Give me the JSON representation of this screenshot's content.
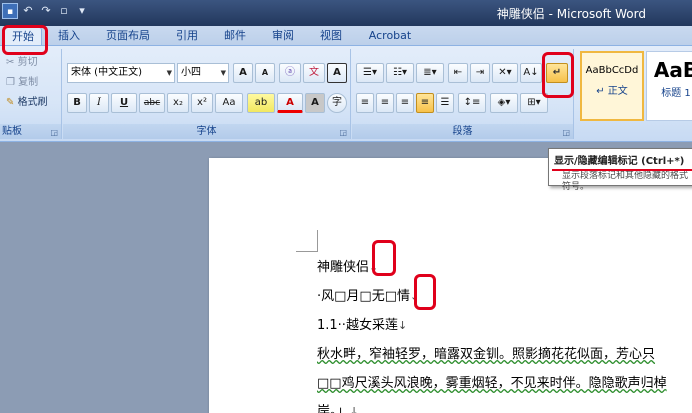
{
  "window": {
    "title": "神雕侠侣 - Microsoft Word"
  },
  "qat": {
    "undo": "↶",
    "redo": "↷"
  },
  "tabs": [
    "开始",
    "插入",
    "页面布局",
    "引用",
    "邮件",
    "审阅",
    "视图",
    "Acrobat"
  ],
  "clipboard": {
    "label": "贴板",
    "cut": "剪切",
    "copy": "复制",
    "format_painter": "格式刷"
  },
  "font": {
    "label": "字体",
    "font_name": "宋体 (中文正文)",
    "font_size": "小四",
    "grow": "A",
    "shrink": "A",
    "clear": "ⓐ",
    "phonetic": "文",
    "border": "A",
    "bold": "B",
    "italic": "I",
    "underline": "U",
    "strike": "abc",
    "subscript": "x₂",
    "superscript": "x²",
    "case": "Aa",
    "highlight": "ab",
    "color": "A",
    "shade": "A",
    "enclose": "字"
  },
  "paragraph": {
    "label": "段落",
    "show_hide": "↵",
    "sort": "A↓"
  },
  "styles": [
    {
      "sample": "AaBbCcDd",
      "name": "正文"
    },
    {
      "sample": "AaB",
      "name": "标题 1"
    }
  ],
  "tooltip": {
    "title": "显示/隐藏编辑标记 (Ctrl+*)",
    "body": "显示段落标记和其他隐藏的格式符号。"
  },
  "document": {
    "lines": [
      {
        "text": "神雕侠侣",
        "mark": "↓"
      },
      {
        "text": "·风□月□无□情",
        "mark": "↓"
      },
      {
        "text": "1.1··越女采莲",
        "mark": "↓"
      },
      {
        "text": "秋水畔，窄袖轻罗，暗露双金钏。照影摘花花似面，芳心只",
        "mark": ""
      },
      {
        "text": "□□鸡尺溪头风浪晚，雾重烟轻，不见来时伴。隐隐歌声归棹",
        "mark": ""
      },
      {
        "text": "岸。」",
        "mark": "↓"
      }
    ]
  },
  "colors": {
    "accent_red": "#e0001b",
    "ribbon": "#dbe7f7",
    "title_bar": "#2a4068"
  }
}
